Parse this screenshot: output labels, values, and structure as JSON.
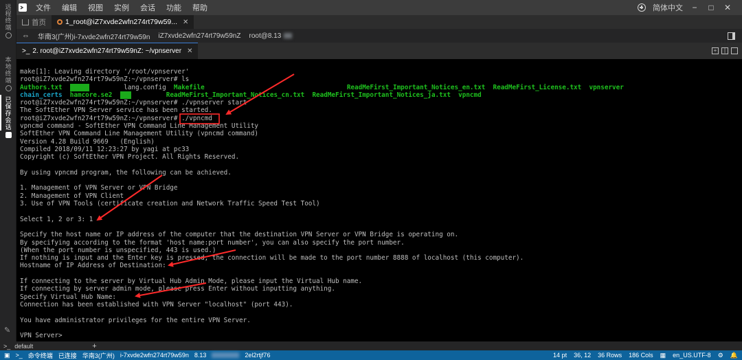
{
  "menubar": {
    "items": [
      "文件",
      "编辑",
      "视图",
      "实例",
      "会话",
      "功能",
      "帮助"
    ],
    "language": "简体中文"
  },
  "activity": {
    "items": [
      "远程终端",
      "本地终端",
      "已保存会话"
    ]
  },
  "tabs": {
    "home": "首页",
    "session": "1_root@iZ7xvde2wfn274rt79w59..."
  },
  "session": {
    "region": "华南3(广州)i-7xvde2wfn274rt79w59n",
    "host": "iZ7xvde2wfn274rt79w59nZ",
    "user": "root@8.13"
  },
  "terminal_tab": {
    "prompt_icon": ">_",
    "label": "2. root@iZ7xvde2wfn274rt79w59nZ: ~/vpnserver"
  },
  "terminal": {
    "lines": [
      [
        {
          "t": "make[1]: Leaving directory '/root/vpnserver'"
        }
      ],
      [
        {
          "t": "root@iZ7xvde2wfn274rt79w59nZ:~/vpnserver# ls"
        }
      ],
      [
        {
          "t": "Authors.txt",
          "s": "g"
        },
        {
          "t": "  "
        },
        {
          "t": "     ",
          "s": "hl"
        },
        {
          "t": "         lang.config  "
        },
        {
          "t": "Makefile",
          "s": "g"
        },
        {
          "t": "                                     "
        },
        {
          "t": "ReadMeFirst_Important_Notices_en.txt",
          "s": "g"
        },
        {
          "t": "  "
        },
        {
          "t": "ReadMeFirst_License.txt",
          "s": "g"
        },
        {
          "t": "  "
        },
        {
          "t": "vpnserver",
          "s": "g"
        }
      ],
      [
        {
          "t": "chain_certs",
          "s": "c"
        },
        {
          "t": "  "
        },
        {
          "t": "hamcore.se2",
          "s": "g"
        },
        {
          "t": "  "
        },
        {
          "t": "   ",
          "s": "hl"
        },
        {
          "t": "         "
        },
        {
          "t": "ReadMeFirst_Important_Notices_cn.txt",
          "s": "g"
        },
        {
          "t": "  "
        },
        {
          "t": "ReadMeFirst_Important_Notices_ja.txt",
          "s": "g"
        },
        {
          "t": "  "
        },
        {
          "t": "vpncmd",
          "s": "g"
        }
      ],
      [
        {
          "t": "root@iZ7xvde2wfn274rt79w59nZ:~/vpnserver# ./vpnserver start"
        }
      ],
      [
        {
          "t": "The SoftEther VPN Server service has been started."
        }
      ],
      [
        {
          "t": "root@iZ7xvde2wfn274rt79w59nZ:~/vpnserver# ./vpncmd"
        }
      ],
      [
        {
          "t": "vpncmd command - SoftEther VPN Command Line Management Utility"
        }
      ],
      [
        {
          "t": "SoftEther VPN Command Line Management Utility (vpncmd command)"
        }
      ],
      [
        {
          "t": "Version 4.28 Build 9669   (English)"
        }
      ],
      [
        {
          "t": "Compiled 2018/09/11 12:23:27 by yagi at pc33"
        }
      ],
      [
        {
          "t": "Copyright (c) SoftEther VPN Project. All Rights Reserved."
        }
      ],
      [
        {
          "t": ""
        }
      ],
      [
        {
          "t": "By using vpncmd program, the following can be achieved."
        }
      ],
      [
        {
          "t": ""
        }
      ],
      [
        {
          "t": "1. Management of VPN Server or VPN Bridge"
        }
      ],
      [
        {
          "t": "2. Management of VPN Client"
        }
      ],
      [
        {
          "t": "3. Use of VPN Tools (certificate creation and Network Traffic Speed Test Tool)"
        }
      ],
      [
        {
          "t": ""
        }
      ],
      [
        {
          "t": "Select 1, 2 or 3: 1"
        }
      ],
      [
        {
          "t": ""
        }
      ],
      [
        {
          "t": "Specify the host name or IP address of the computer that the destination VPN Server or VPN Bridge is operating on."
        }
      ],
      [
        {
          "t": "By specifying according to the format 'host name:port number', you can also specify the port number."
        }
      ],
      [
        {
          "t": "(When the port number is unspecified, 443 is used.)"
        }
      ],
      [
        {
          "t": "If nothing is input and the Enter key is pressed, the connection will be made to the port number 8888 of localhost (this computer)."
        }
      ],
      [
        {
          "t": "Hostname of IP Address of Destination:"
        }
      ],
      [
        {
          "t": ""
        }
      ],
      [
        {
          "t": "If connecting to the server by Virtual Hub Admin Mode, please input the Virtual Hub name."
        }
      ],
      [
        {
          "t": "If connecting by server admin mode, please press Enter without inputting anything."
        }
      ],
      [
        {
          "t": "Specify Virtual Hub Name:"
        }
      ],
      [
        {
          "t": "Connection has been established with VPN Server \"localhost\" (port 443)."
        }
      ],
      [
        {
          "t": ""
        }
      ],
      [
        {
          "t": "You have administrator privileges for the entire VPN Server."
        }
      ],
      [
        {
          "t": ""
        }
      ],
      [
        {
          "t": "VPN Server>"
        }
      ]
    ]
  },
  "panel": {
    "terminal_name": "default",
    "add_label": "+"
  },
  "status": {
    "command_terminal": "命令终端",
    "connected": "已连接",
    "region": "华南3(广州)",
    "instance": "i-7xvde2wfn274rt79w59n",
    "ip_prefix": "8.13",
    "ip_suffix": "2el2rtjf76",
    "font_size": "14 pt",
    "cursor": "36, 12",
    "rows": "36 Rows",
    "cols": "186 Cols",
    "encoding": "en_US.UTF-8"
  },
  "colors": {
    "green_text": "#1ec01e",
    "cyan_text": "#19a3c6",
    "annotation_red": "#ff2a2a",
    "status_blue": "#0e639c"
  }
}
